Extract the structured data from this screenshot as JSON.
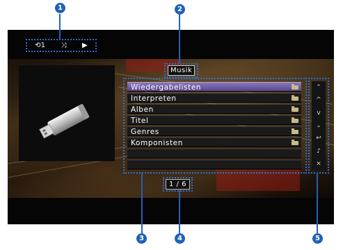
{
  "callouts": [
    "1",
    "2",
    "3",
    "4",
    "5"
  ],
  "playback_icons": {
    "repeat": "repeat-icon",
    "shuffle": "shuffle-icon",
    "play": "play-icon",
    "repeat_glyph": "⟲1",
    "shuffle_glyph": "⤨",
    "play_glyph": "▶"
  },
  "header": {
    "title": "Musik"
  },
  "list": {
    "items": [
      {
        "label": "Wiedergabelisten",
        "selected": true
      },
      {
        "label": "Interpreten",
        "selected": false
      },
      {
        "label": "Alben",
        "selected": false
      },
      {
        "label": "Titel",
        "selected": false
      },
      {
        "label": "Genres",
        "selected": false
      },
      {
        "label": "Komponisten",
        "selected": false
      },
      {
        "label": "",
        "selected": false
      },
      {
        "label": "",
        "selected": false
      }
    ]
  },
  "pagination": {
    "text": "1 / 6"
  },
  "nav_buttons": [
    {
      "name": "page-up-icon",
      "glyph": "⌃"
    },
    {
      "name": "up-icon",
      "glyph": "^"
    },
    {
      "name": "down-icon",
      "glyph": "v"
    },
    {
      "name": "page-down-icon",
      "glyph": "⌄"
    },
    {
      "name": "return-icon",
      "glyph": "↩"
    },
    {
      "name": "now-playing-icon",
      "glyph": "♪"
    },
    {
      "name": "close-icon",
      "glyph": "×"
    }
  ],
  "colors": {
    "accent": "#2162b8",
    "selected_row": "#6a55a0"
  }
}
